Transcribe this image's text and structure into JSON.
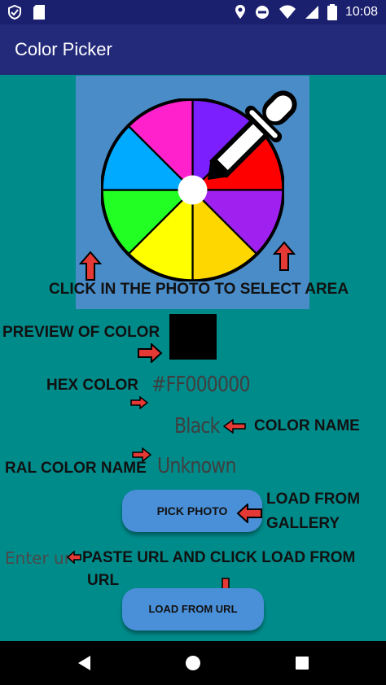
{
  "status": {
    "time": "10:08"
  },
  "app": {
    "title": "Color Picker"
  },
  "labels": {
    "click_instruction": "CLICK IN THE PHOTO TO SELECT AREA",
    "preview_label": "PREVIEW OF COLOR",
    "hex_label": "HEX COLOR",
    "color_name_label": "COLOR NAME",
    "ral_label": "RAL COLOR NAME",
    "load_gallery_line1": "LOAD FROM",
    "load_gallery_line2": "GALLERY",
    "paste_line1": "PASTE URL AND CLICK LOAD FROM",
    "paste_line2": "URL"
  },
  "values": {
    "hex": "#FF000000",
    "color_name": "Black",
    "ral_name": "Unknown"
  },
  "buttons": {
    "pick_photo": "PICK PHOTO",
    "load_url": "LOAD FROM URL"
  },
  "inputs": {
    "url_placeholder": "Enter url"
  },
  "colors": {
    "preview": "#000000",
    "background": "#008B8B",
    "button": "#4A90D9",
    "arrow": "#E53935"
  }
}
